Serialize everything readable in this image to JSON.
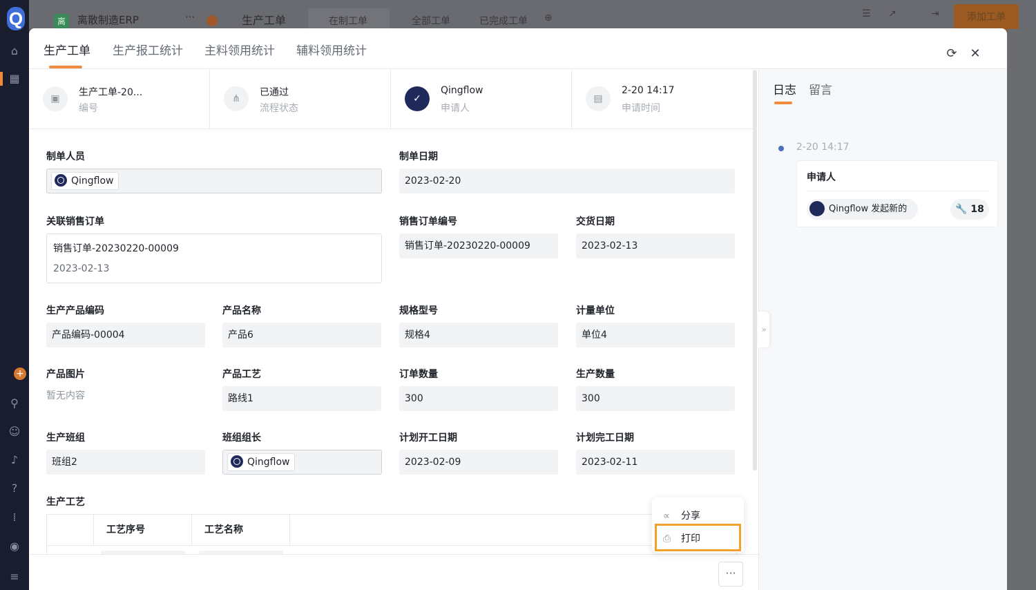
{
  "topbar": {
    "app_icon": "离",
    "app_name": "离散制造ERP",
    "more": "···",
    "section_title": "生产工单",
    "tabs": [
      "在制工单",
      "全部工单",
      "已完成工单"
    ],
    "add_button": "添加工单"
  },
  "modal": {
    "tabs": [
      "生产工单",
      "生产报工统计",
      "主料领用统计",
      "辅料领用统计"
    ],
    "active_tab": 0,
    "info": [
      {
        "value": "生产工单-20...",
        "label": "编号",
        "icon": "id-icon"
      },
      {
        "value": "已通过",
        "label": "流程状态",
        "icon": "flow-icon"
      },
      {
        "value": "Qingflow",
        "label": "申请人",
        "icon": "avatar"
      },
      {
        "value": "2-20 14:17",
        "label": "申请时间",
        "icon": "calendar-icon"
      }
    ],
    "form": {
      "maker": {
        "label": "制单人员",
        "value": "Qingflow"
      },
      "make_date": {
        "label": "制单日期",
        "value": "2023-02-20"
      },
      "sales_order": {
        "label": "关联销售订单",
        "line1": "销售订单-20230220-00009",
        "line2": "2023-02-13"
      },
      "sales_order_no": {
        "label": "销售订单编号",
        "value": "销售订单-20230220-00009"
      },
      "delivery_date": {
        "label": "交货日期",
        "value": "2023-02-13"
      },
      "product_code": {
        "label": "生产产品编码",
        "value": "产品编码-00004"
      },
      "product_name": {
        "label": "产品名称",
        "value": "产品6"
      },
      "spec": {
        "label": "规格型号",
        "value": "规格4"
      },
      "unit": {
        "label": "计量单位",
        "value": "单位4"
      },
      "product_image": {
        "label": "产品图片",
        "value": "暂无内容"
      },
      "process": {
        "label": "产品工艺",
        "value": "路线1"
      },
      "order_qty": {
        "label": "订单数量",
        "value": "300"
      },
      "prod_qty": {
        "label": "生产数量",
        "value": "300"
      },
      "team": {
        "label": "生产班组",
        "value": "班组2"
      },
      "leader": {
        "label": "班组组长",
        "value": "Qingflow"
      },
      "plan_start": {
        "label": "计划开工日期",
        "value": "2023-02-09"
      },
      "plan_end": {
        "label": "计划完工日期",
        "value": "2023-02-11"
      },
      "process_table": {
        "label": "生产工艺",
        "columns": [
          "工艺序号",
          "工艺名称"
        ]
      }
    },
    "menu": {
      "share": "分享",
      "print": "打印"
    },
    "more_button": "···"
  },
  "log": {
    "tabs": [
      "日志",
      "留言"
    ],
    "time": "2-20 14:17",
    "card_title": "申请人",
    "event": "Qingflow 发起新的",
    "count": "18"
  },
  "colors": {
    "accent": "#f08a3c",
    "highlight": "#f2a12a",
    "avatar": "#1f2a5a"
  }
}
